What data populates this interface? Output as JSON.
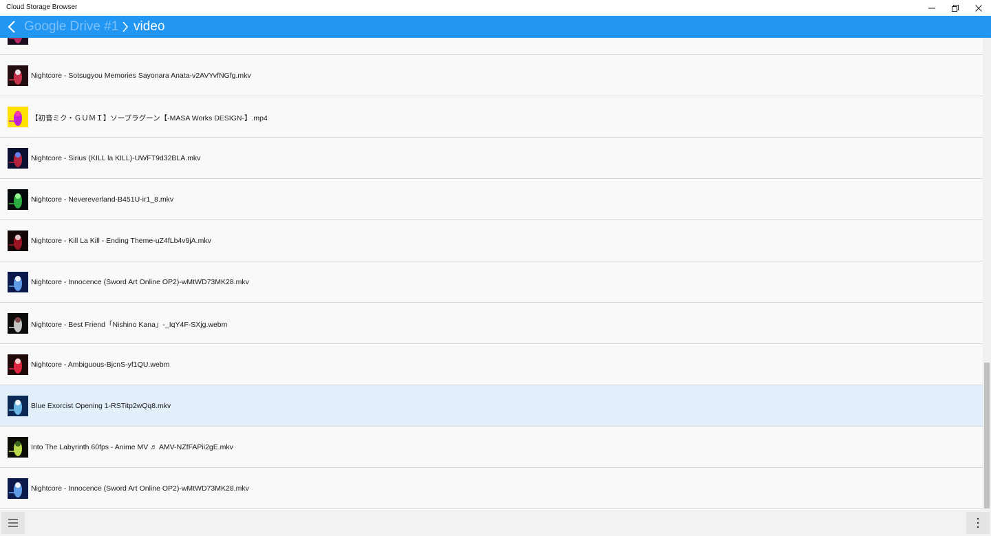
{
  "window": {
    "title": "Cloud Storage Browser",
    "controls": [
      "minimize-icon",
      "restore-icon",
      "close-icon"
    ]
  },
  "navbar": {
    "back_icon": "chevron-left-icon",
    "root_label": "Google Drive #1",
    "separator_icon": "chevron-right-icon",
    "current_label": "video",
    "bar_color": "#2196f3"
  },
  "files": [
    {
      "name": "",
      "thumb": "video-thumbnail",
      "partial": true
    },
    {
      "name": "Nightcore - Sotsugyou Memories Sayonara Anata-v2AVYvfNGfg.mkv",
      "thumb": "video-thumbnail"
    },
    {
      "name": "【初音ミク・ＧＵＭＩ】ソープラグーン【-MASA Works DESIGN-】.mp4",
      "thumb": "video-thumbnail"
    },
    {
      "name": "Nightcore - Sirius (KILL la KILL)-UWFT9d32BLA.mkv",
      "thumb": "video-thumbnail"
    },
    {
      "name": "Nightcore - Nevereverland-B451U-ir1_8.mkv",
      "thumb": "video-thumbnail"
    },
    {
      "name": "Nightcore - Kill La Kill - Ending Theme-uZ4fLb4v9jA.mkv",
      "thumb": "video-thumbnail"
    },
    {
      "name": "Nightcore - Innocence (Sword Art Online OP2)-wMtWD73MK28.mkv",
      "thumb": "video-thumbnail"
    },
    {
      "name": "Nightcore - Best Friend「Nishino Kana」-_IqY4F-SXjg.webm",
      "thumb": "video-thumbnail"
    },
    {
      "name": "Nightcore - Ambiguous-BjcnS-yf1QU.webm",
      "thumb": "video-thumbnail"
    },
    {
      "name": "Blue Exorcist Opening 1-RSTitp2wQq8.mkv",
      "thumb": "video-thumbnail",
      "selected": true
    },
    {
      "name": "Into The Labyrinth 60fps - Anime MV ♬ AMV-NZfFAPii2gE.mkv",
      "thumb": "video-thumbnail"
    },
    {
      "name": "Nightcore - Innocence (Sword Art Online OP2)-wMtWD73MK28.mkv",
      "thumb": "video-thumbnail"
    }
  ],
  "bottombar": {
    "menu_icon": "hamburger-menu-icon",
    "more_icon": "more-vertical-icon"
  },
  "colors": {
    "selected_row": "#e2eef9",
    "row_background": "#f9f9f9",
    "divider": "#d8d8d8"
  }
}
